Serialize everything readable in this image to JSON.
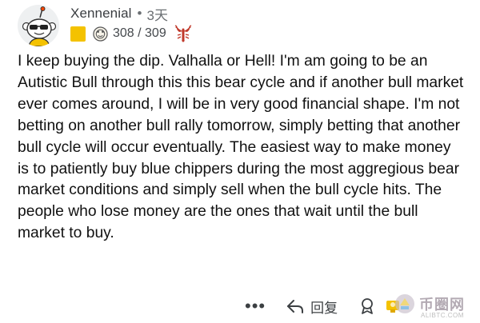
{
  "comment": {
    "author": {
      "username": "Xennenial",
      "separator": "•",
      "time_ago": "3天"
    },
    "flair": {
      "color": "#f4c200",
      "coin_icon": "coin-icon",
      "score": "308 / 309",
      "badge_icon": "lobster-icon"
    },
    "body": "I keep buying the dip. Valhalla or Hell! I'm am going to be an Autistic Bull through this this bear cycle and if another bull market ever comes around, I will be in very good financial shape. I'm not betting on another bull rally tomorrow, simply betting that another bull cycle will occur eventually. The easiest way to make money is to patiently buy blue chippers during the most aggregious bear market conditions and simply sell when the bull cycle hits. The people who lose money are the ones that wait until the bull market to buy.",
    "actions": {
      "more_label": "•••",
      "reply_label": "回复"
    }
  },
  "watermark": {
    "name": "币圈网",
    "url": "ALIBTC.COM"
  }
}
